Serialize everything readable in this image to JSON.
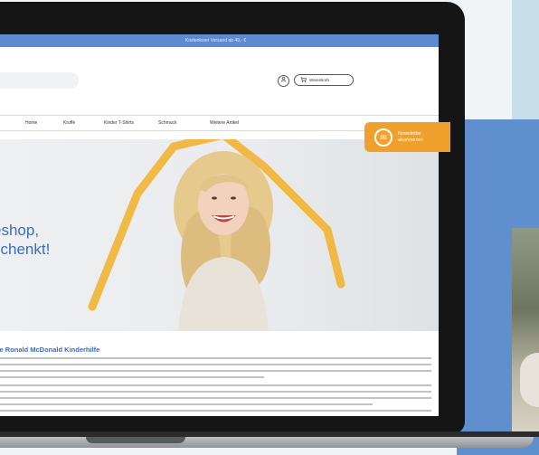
{
  "topbar": {
    "text": "Kostenloser Versand ab 49,- €"
  },
  "header": {
    "search": {
      "value": "",
      "placeholder": ""
    },
    "user_icon": "user-icon",
    "cart_icon": "cart-icon",
    "cart_label": "Warenkorb"
  },
  "nav": {
    "items": [
      {
        "label": "Home"
      },
      {
        "label": "Kruffe"
      },
      {
        "label": "Kinder T-Shirts"
      },
      {
        "label": "Schmuck"
      },
      {
        "label": "Weitere Artikel"
      }
    ]
  },
  "hero": {
    "title_line1": "eshop,",
    "title_line2": "schenkt!",
    "subtitle": ""
  },
  "newsletter": {
    "icon": "mail-icon",
    "line1": "Newsletter",
    "line2": "abonnieren"
  },
  "content": {
    "title": "Die Ronald McDonald Kinderhilfe"
  },
  "colors": {
    "topbar": "#5d8ad0",
    "accent_blue": "#3c6bbd",
    "newsletter_orange": "#f0a02d",
    "hero_yellow": "#f2b233",
    "background_blue": "#5f8fcd",
    "background_paleblue": "#c7dfe8"
  }
}
